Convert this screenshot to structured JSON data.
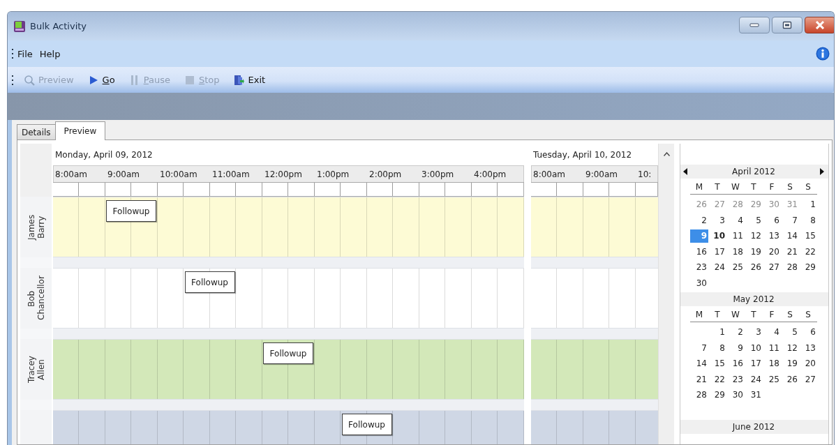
{
  "window": {
    "title": "Bulk Activity"
  },
  "menu": {
    "items": [
      "File",
      "Help"
    ]
  },
  "toolbar": [
    {
      "kind": "preview",
      "label": "Preview",
      "disabled": true,
      "mnemonic": false
    },
    {
      "kind": "go",
      "label": "Go",
      "disabled": false,
      "mnemonic": true
    },
    {
      "kind": "pause",
      "label": "Pause",
      "disabled": true,
      "mnemonic": true
    },
    {
      "kind": "stop",
      "label": "Stop",
      "disabled": true,
      "mnemonic": true
    },
    {
      "kind": "exit",
      "label": "Exit",
      "disabled": false,
      "mnemonic": false
    }
  ],
  "tabs": [
    {
      "label": "Details",
      "selected": false
    },
    {
      "label": "Preview",
      "selected": true
    }
  ],
  "scheduler": {
    "days": [
      {
        "label": "Monday, April 09, 2012",
        "times": [
          "8:00am",
          "9:00am",
          "10:00am",
          "11:00am",
          "12:00pm",
          "1:00pm",
          "2:00pm",
          "3:00pm",
          "4:00pm"
        ]
      },
      {
        "label": "Tuesday, April 10, 2012",
        "times": [
          "8:00am",
          "9:00am",
          "10:"
        ]
      }
    ],
    "resources": [
      {
        "name": "James Barry",
        "color": "#fdfbd5",
        "slots": [
          {
            "kind": "free"
          },
          {
            "kind": "free"
          },
          {
            "kind": "appointment",
            "label": "Followup"
          },
          {
            "kind": "busy"
          }
        ]
      },
      {
        "name": "Bob Chancellor",
        "color": "#ffffff",
        "slots": [
          {
            "kind": "free"
          },
          {
            "kind": "free"
          },
          {
            "kind": "free"
          },
          {
            "kind": "free"
          },
          {
            "kind": "free"
          },
          {
            "kind": "appointment",
            "label": "Followup"
          },
          {
            "kind": "busy"
          }
        ]
      },
      {
        "name": "Tracey Allen",
        "color": "#d3e8b9",
        "slots": [
          {
            "kind": "free"
          },
          {
            "kind": "free"
          },
          {
            "kind": "free"
          },
          {
            "kind": "free"
          },
          {
            "kind": "free"
          },
          {
            "kind": "free"
          },
          {
            "kind": "free"
          },
          {
            "kind": "free"
          },
          {
            "kind": "appointment",
            "label": "Followup"
          },
          {
            "kind": "busy"
          }
        ]
      },
      {
        "color": "#cfd7e5",
        "slots": [
          {
            "kind": "free"
          },
          {
            "kind": "free"
          },
          {
            "kind": "free"
          },
          {
            "kind": "free"
          },
          {
            "kind": "free"
          },
          {
            "kind": "free"
          },
          {
            "kind": "free"
          },
          {
            "kind": "free"
          },
          {
            "kind": "free"
          },
          {
            "kind": "free"
          },
          {
            "kind": "free"
          },
          {
            "kind": "appointment",
            "label": "Followup"
          },
          {
            "kind": "busy"
          }
        ]
      }
    ]
  },
  "calendar": {
    "months": [
      {
        "title": "April 2012",
        "navigation": true,
        "weekdays": [
          "M",
          "T",
          "W",
          "T",
          "F",
          "S",
          "S"
        ],
        "weeks": [
          {
            "kind": "leading",
            "days": [
              {
                "d": "26",
                "other": true,
                "selected": false,
                "today": false
              },
              {
                "d": "27",
                "other": true,
                "selected": false,
                "today": false
              },
              {
                "d": "28",
                "other": true,
                "selected": false,
                "today": false
              },
              {
                "d": "29",
                "other": true,
                "selected": false,
                "today": false
              },
              {
                "d": "30",
                "other": true,
                "selected": false,
                "today": false
              },
              {
                "d": "31",
                "other": true,
                "selected": false,
                "today": false
              },
              {
                "d": "1",
                "other": false,
                "selected": false,
                "today": false
              }
            ]
          },
          {
            "kind": "full",
            "days": [
              {
                "d": "2",
                "other": false,
                "selected": false,
                "today": false
              },
              {
                "d": "3",
                "other": false,
                "selected": false,
                "today": false
              },
              {
                "d": "4",
                "other": false,
                "selected": false,
                "today": false
              },
              {
                "d": "5",
                "other": false,
                "selected": false,
                "today": false
              },
              {
                "d": "6",
                "other": false,
                "selected": false,
                "today": false
              },
              {
                "d": "7",
                "other": false,
                "selected": false,
                "today": false
              },
              {
                "d": "8",
                "other": false,
                "selected": false,
                "today": false
              }
            ]
          },
          {
            "kind": "full",
            "days": [
              {
                "d": "9",
                "other": false,
                "selected": true,
                "today": false
              },
              {
                "d": "10",
                "other": false,
                "selected": false,
                "today": true
              },
              {
                "d": "11",
                "other": false,
                "selected": false,
                "today": false
              },
              {
                "d": "12",
                "other": false,
                "selected": false,
                "today": false
              },
              {
                "d": "13",
                "other": false,
                "selected": false,
                "today": false
              },
              {
                "d": "14",
                "other": false,
                "selected": false,
                "today": false
              },
              {
                "d": "15",
                "other": false,
                "selected": false,
                "today": false
              }
            ]
          },
          {
            "kind": "full",
            "days": [
              {
                "d": "16",
                "other": false,
                "selected": false,
                "today": false
              },
              {
                "d": "17",
                "other": false,
                "selected": false,
                "today": false
              },
              {
                "d": "18",
                "other": false,
                "selected": false,
                "today": false
              },
              {
                "d": "19",
                "other": false,
                "selected": false,
                "today": false
              },
              {
                "d": "20",
                "other": false,
                "selected": false,
                "today": false
              },
              {
                "d": "21",
                "other": false,
                "selected": false,
                "today": false
              },
              {
                "d": "22",
                "other": false,
                "selected": false,
                "today": false
              }
            ]
          },
          {
            "kind": "full",
            "days": [
              {
                "d": "23",
                "other": false,
                "selected": false,
                "today": false
              },
              {
                "d": "24",
                "other": false,
                "selected": false,
                "today": false
              },
              {
                "d": "25",
                "other": false,
                "selected": false,
                "today": false
              },
              {
                "d": "26",
                "other": false,
                "selected": false,
                "today": false
              },
              {
                "d": "27",
                "other": false,
                "selected": false,
                "today": false
              },
              {
                "d": "28",
                "other": false,
                "selected": false,
                "today": false
              },
              {
                "d": "29",
                "other": false,
                "selected": false,
                "today": false
              }
            ]
          },
          {
            "kind": "full",
            "days": [
              {
                "d": "30",
                "other": false,
                "selected": false,
                "today": false
              }
            ]
          }
        ]
      },
      {
        "title": "May 2012",
        "navigation": false,
        "weekdays": [
          "M",
          "T",
          "W",
          "T",
          "F",
          "S",
          "S"
        ],
        "weeks": [
          {
            "kind": "leading",
            "days": [
              {
                "d": "1",
                "other": false,
                "selected": false,
                "today": false
              },
              {
                "d": "2",
                "other": false,
                "selected": false,
                "today": false
              },
              {
                "d": "3",
                "other": false,
                "selected": false,
                "today": false
              },
              {
                "d": "4",
                "other": false,
                "selected": false,
                "today": false
              },
              {
                "d": "5",
                "other": false,
                "selected": false,
                "today": false
              },
              {
                "d": "6",
                "other": false,
                "selected": false,
                "today": false
              }
            ]
          },
          {
            "kind": "full",
            "days": [
              {
                "d": "7",
                "other": false,
                "selected": false,
                "today": false
              },
              {
                "d": "8",
                "other": false,
                "selected": false,
                "today": false
              },
              {
                "d": "9",
                "other": false,
                "selected": false,
                "today": false
              },
              {
                "d": "10",
                "other": false,
                "selected": false,
                "today": false
              },
              {
                "d": "11",
                "other": false,
                "selected": false,
                "today": false
              },
              {
                "d": "12",
                "other": false,
                "selected": false,
                "today": false
              },
              {
                "d": "13",
                "other": false,
                "selected": false,
                "today": false
              }
            ]
          },
          {
            "kind": "full",
            "days": [
              {
                "d": "14",
                "other": false,
                "selected": false,
                "today": false
              },
              {
                "d": "15",
                "other": false,
                "selected": false,
                "today": false
              },
              {
                "d": "16",
                "other": false,
                "selected": false,
                "today": false
              },
              {
                "d": "17",
                "other": false,
                "selected": false,
                "today": false
              },
              {
                "d": "18",
                "other": false,
                "selected": false,
                "today": false
              },
              {
                "d": "19",
                "other": false,
                "selected": false,
                "today": false
              },
              {
                "d": "20",
                "other": false,
                "selected": false,
                "today": false
              }
            ]
          },
          {
            "kind": "full",
            "days": [
              {
                "d": "21",
                "other": false,
                "selected": false,
                "today": false
              },
              {
                "d": "22",
                "other": false,
                "selected": false,
                "today": false
              },
              {
                "d": "23",
                "other": false,
                "selected": false,
                "today": false
              },
              {
                "d": "24",
                "other": false,
                "selected": false,
                "today": false
              },
              {
                "d": "25",
                "other": false,
                "selected": false,
                "today": false
              },
              {
                "d": "26",
                "other": false,
                "selected": false,
                "today": false
              },
              {
                "d": "27",
                "other": false,
                "selected": false,
                "today": false
              }
            ]
          },
          {
            "kind": "full",
            "days": [
              {
                "d": "28",
                "other": false,
                "selected": false,
                "today": false
              },
              {
                "d": "29",
                "other": false,
                "selected": false,
                "today": false
              },
              {
                "d": "30",
                "other": false,
                "selected": false,
                "today": false
              },
              {
                "d": "31",
                "other": false,
                "selected": false,
                "today": false
              }
            ]
          }
        ]
      },
      {
        "title": "June 2012",
        "navigation": false
      }
    ]
  }
}
